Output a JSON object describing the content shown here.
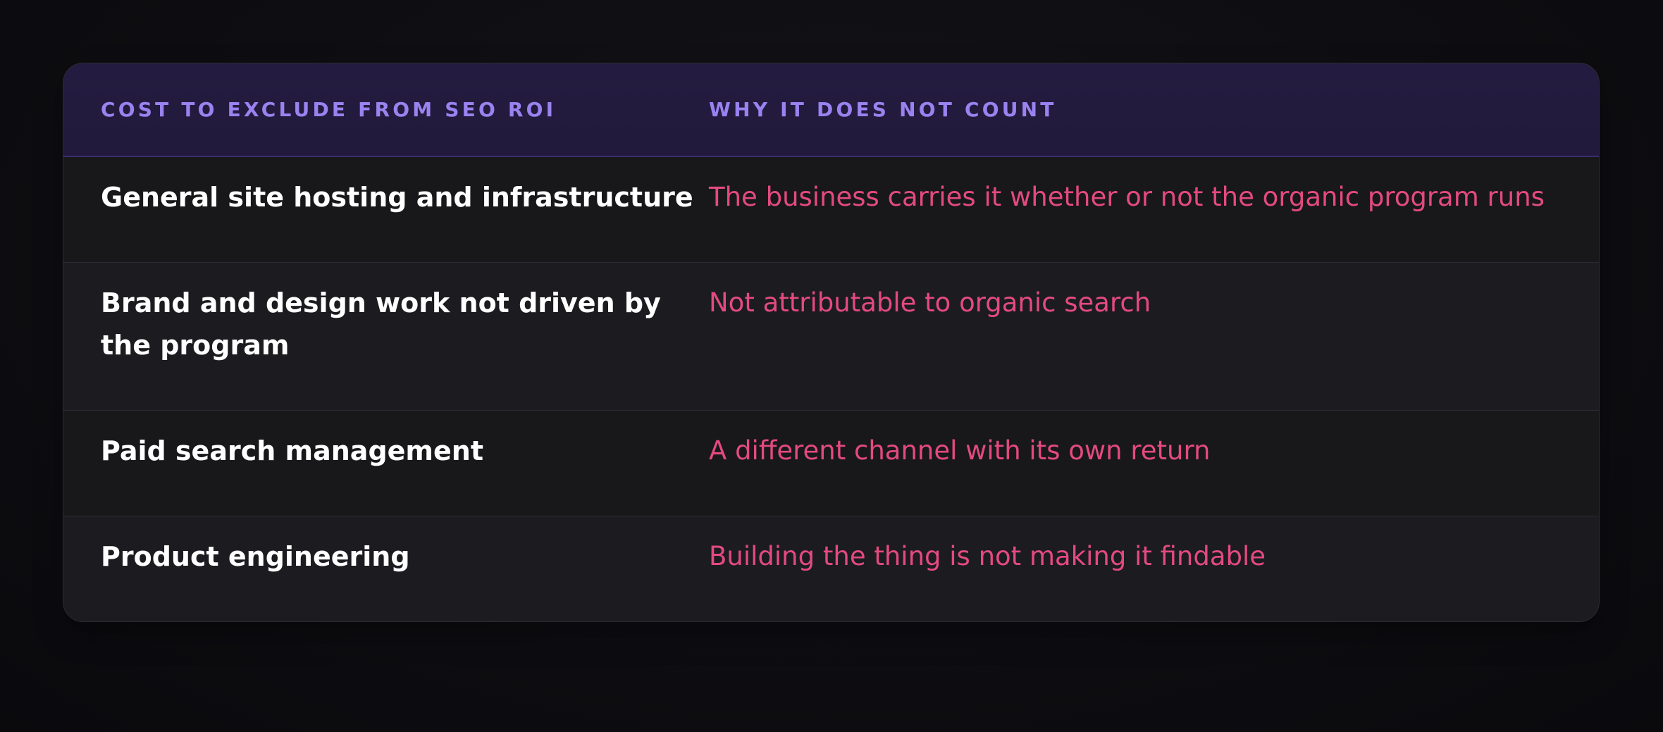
{
  "table": {
    "headers": {
      "cost": "COST TO EXCLUDE FROM SEO ROI",
      "reason": "WHY IT DOES NOT COUNT"
    },
    "rows": [
      {
        "cost": "General site hosting and infrastructure",
        "reason": "The business carries it whether or not the organic program runs"
      },
      {
        "cost": "Brand and design work not driven by the program",
        "reason": "Not attributable to organic search"
      },
      {
        "cost": "Paid search management",
        "reason": "A different channel with its own return"
      },
      {
        "cost": "Product engineering",
        "reason": "Building the thing is not making it findable"
      }
    ]
  },
  "colors": {
    "header_text": "#9a82f0",
    "header_bg": "#231b3e",
    "row_text": "#ffffff",
    "reason_text": "#e44a7e",
    "page_bg": "#0e0e12"
  }
}
